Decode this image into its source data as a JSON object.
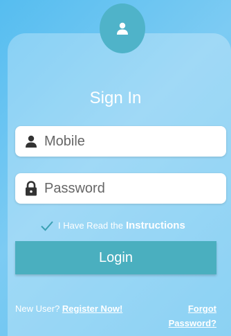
{
  "form": {
    "title": "Sign In",
    "mobile_placeholder": "Mobile",
    "password_placeholder": "Password",
    "terms_prefix": "I Have Read the",
    "terms_link": "Instructions",
    "login_label": "Login"
  },
  "footer": {
    "new_user_text": "New User?",
    "register_link": "Register Now!",
    "forgot_link": "Forgot Password?"
  },
  "colors": {
    "background": "#6cc6f2",
    "accent": "#4aafbf",
    "text": "#ffffff"
  },
  "icons": {
    "avatar": "user-icon",
    "mobile": "user-icon",
    "password": "lock-icon",
    "terms": "check-icon"
  }
}
